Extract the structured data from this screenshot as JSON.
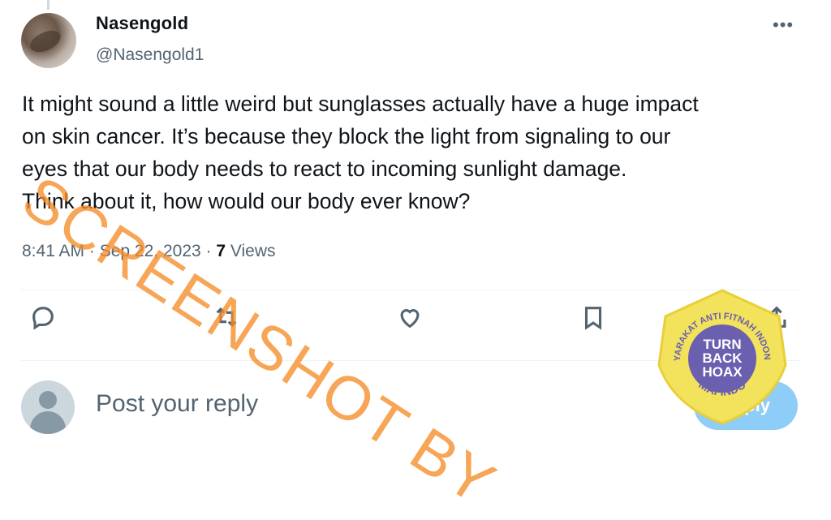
{
  "tweet": {
    "display_name": "Nasengold",
    "handle": "@Nasengold1",
    "more_icon": "more-horizontal-icon",
    "lines": [
      "It might sound a little weird but sunglasses actually have a huge impact",
      "on skin cancer. It’s because they block the light from signaling to our",
      "eyes that our body needs to react to incoming sunlight damage.",
      "Think about it, how would our body ever know?"
    ],
    "time": "8:41 AM",
    "date": "Sep 22, 2023",
    "separator": " · ",
    "views_count": "7",
    "views_label": "Views"
  },
  "actions": [
    {
      "name": "reply-icon"
    },
    {
      "name": "retweet-icon"
    },
    {
      "name": "like-icon"
    },
    {
      "name": "bookmark-icon"
    },
    {
      "name": "share-icon"
    }
  ],
  "reply": {
    "placeholder": "Post your reply",
    "button_label": "Reply"
  },
  "watermark": {
    "text": "SCREENSHOT BY",
    "color": "#f58c28"
  },
  "badge": {
    "ring_text": "MASYARAKAT ANTI FITNAH INDONESIA",
    "bottom_text": "MAFINDO",
    "center_lines": [
      "TURN",
      "BACK",
      "HOAX"
    ],
    "colors": {
      "yellow": "#f2e25c",
      "purple": "#6b5fb0"
    }
  }
}
